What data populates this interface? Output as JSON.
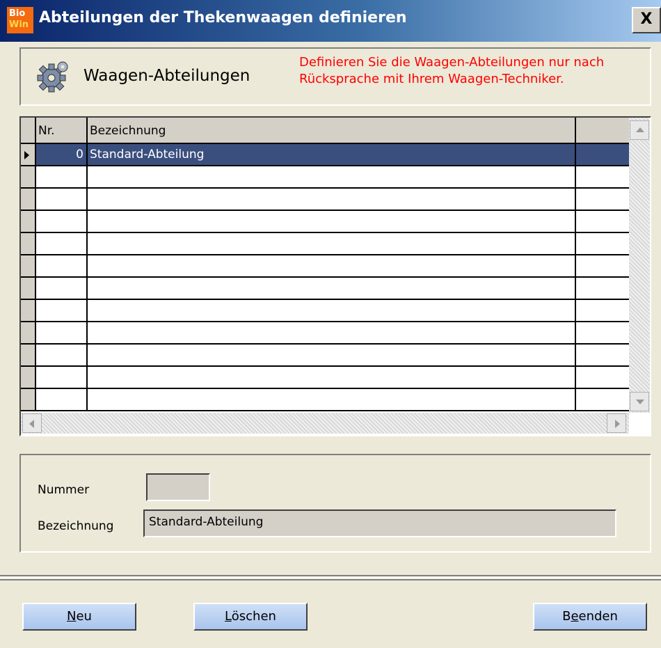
{
  "window": {
    "title": "Abteilungen der Thekenwaagen definieren",
    "app_icon_line1": "Bio",
    "app_icon_line2": "Win",
    "close_label": "X"
  },
  "header": {
    "title": "Waagen-Abteilungen",
    "warning_line1": "Definieren Sie die Waagen-Abteilungen nur nach",
    "warning_line2": "Rücksprache mit Ihrem Waagen-Techniker.",
    "warning_color": "#ff0000",
    "icon": "gear-icon"
  },
  "grid": {
    "columns": [
      "Nr.",
      "Bezeichnung",
      ""
    ],
    "rows": [
      {
        "nr": "0",
        "bezeichnung": "Standard-Abteilung",
        "selected": true
      }
    ],
    "empty_row_count": 11,
    "selection_color": "#3b4f7f"
  },
  "detail": {
    "nummer_label": "Nummer",
    "nummer_value": "",
    "bezeichnung_label": "Bezeichnung",
    "bezeichnung_value": "Standard-Abteilung"
  },
  "buttons": {
    "neu": {
      "mnemonic": "N",
      "rest": "eu"
    },
    "loeschen": {
      "mnemonic": "L",
      "rest": "öschen"
    },
    "beenden": {
      "pre": "B",
      "mnemonic": "e",
      "rest": "enden"
    }
  }
}
